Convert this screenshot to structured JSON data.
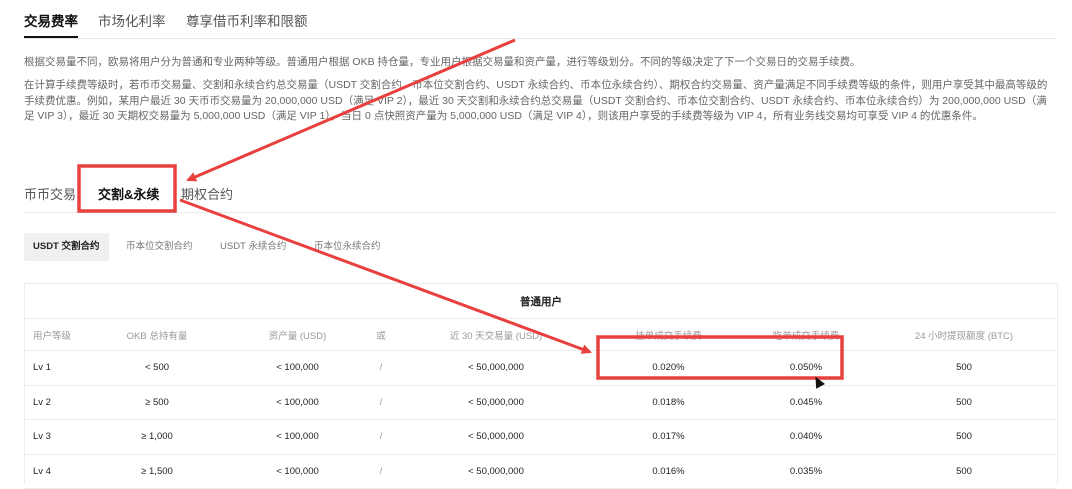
{
  "top_tabs": [
    "交易费率",
    "市场化利率",
    "尊享借币利率和限额"
  ],
  "description": {
    "p1": "根据交易量不同，欧易将用户分为普通和专业两种等级。普通用户根据 OKB 持仓量，专业用户根据交易量和资产量，进行等级划分。不同的等级决定了下一个交易日的交易手续费。",
    "p2": "在计算手续费等级时，若币币交易量、交割和永续合约总交易量（USDT 交割合约、币本位交割合约、USDT 永续合约、币本位永续合约）、期权合约交易量、资产量满足不同手续费等级的条件，则用户享受其中最高等级的手续费优惠。例如，某用户最近 30 天币币交易量为 20,000,000 USD（满足 VIP 2），最近 30 天交割和永续合约总交易量（USDT 交割合约、币本位交割合约、USDT 永续合约、币本位永续合约）为 200,000,000 USD（满足 VIP 3），最近 30 天期权交易量为 5,000,000 USD（满足 VIP 1），当日 0 点快照资产量为 5,000,000 USD（满足 VIP 4），则该用户享受的手续费等级为 VIP 4，所有业务线交易均可享受 VIP 4 的优惠条件。"
  },
  "product_tabs": [
    "币币交易",
    "交割&永续",
    "期权合约"
  ],
  "sub_tabs": [
    "USDT 交割合约",
    "币本位交割合约",
    "USDT 永续合约",
    "币本位永续合约"
  ],
  "table": {
    "group_title": "普通用户",
    "columns": [
      "用户等级",
      "OKB 总持有量",
      "资产量 (USD)",
      "或",
      "近 30 天交易量 (USD)",
      "挂单成交手续费",
      "吃单成交手续费",
      "24 小时提现额度 (BTC)"
    ],
    "rows": [
      [
        "Lv 1",
        "< 500",
        "< 100,000",
        "/",
        "< 50,000,000",
        "0.020%",
        "0.050%",
        "500"
      ],
      [
        "Lv 2",
        "≥ 500",
        "< 100,000",
        "/",
        "< 50,000,000",
        "0.018%",
        "0.045%",
        "500"
      ],
      [
        "Lv 3",
        "≥ 1,000",
        "< 100,000",
        "/",
        "< 50,000,000",
        "0.017%",
        "0.040%",
        "500"
      ],
      [
        "Lv 4",
        "≥ 1,500",
        "< 100,000",
        "/",
        "< 50,000,000",
        "0.016%",
        "0.035%",
        "500"
      ]
    ]
  },
  "annotation_color": "#e8403f"
}
